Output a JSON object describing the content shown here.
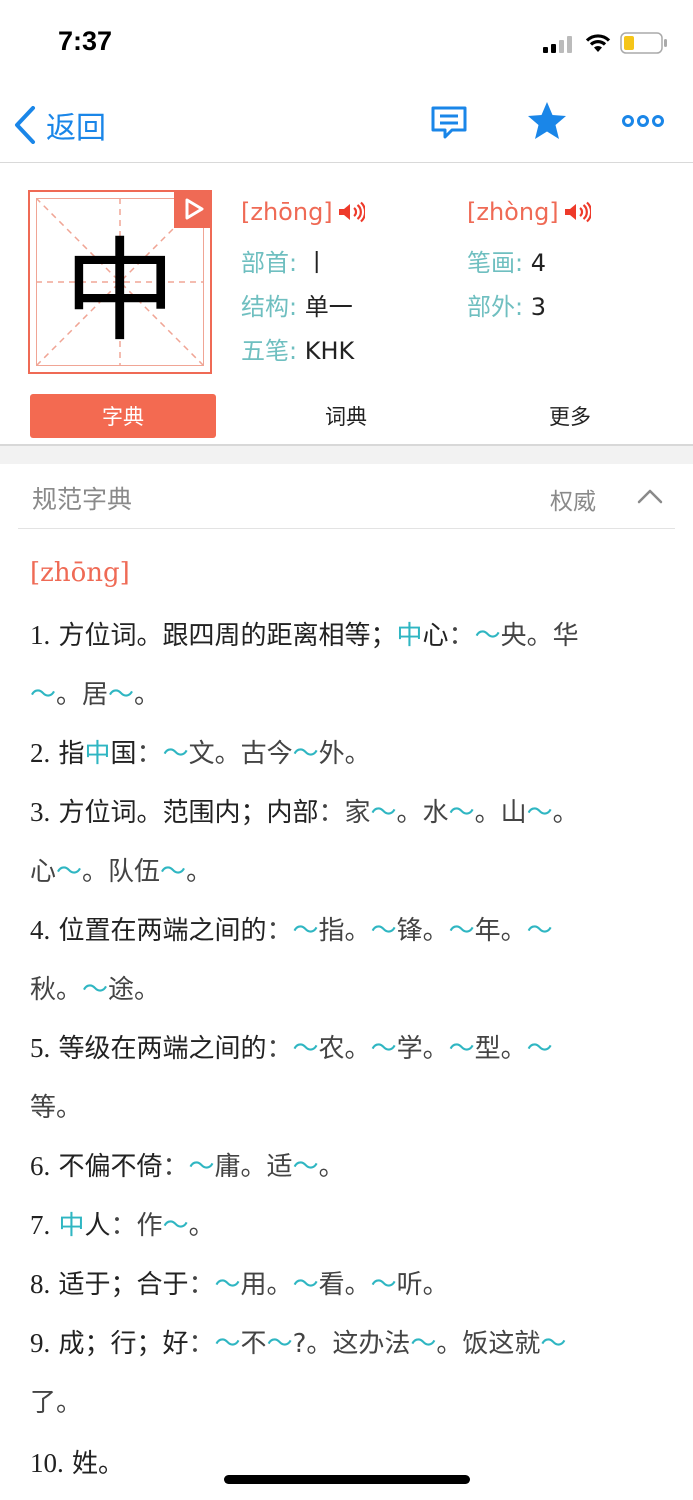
{
  "status": {
    "time": "7:37"
  },
  "nav": {
    "back_label": "返回"
  },
  "char": {
    "glyph": "中",
    "pinyin1": "[zhōng]",
    "pinyin2": "[zhòng]",
    "radical_label": "部首:",
    "radical_value": "丨",
    "strokes_label": "笔画:",
    "strokes_value": "4",
    "structure_label": "结构:",
    "structure_value": "单一",
    "extra_label": "部外:",
    "extra_value": "3",
    "wubi_label": "五笔:",
    "wubi_value": "KHK"
  },
  "tabs": [
    {
      "label": "字典"
    },
    {
      "label": "词典"
    },
    {
      "label": "更多"
    }
  ],
  "dict": {
    "title": "规范字典",
    "authority": "权威",
    "entry_pinyin": "[zhōng]"
  },
  "definitions": [
    [
      [
        [
          "n",
          "1."
        ],
        [
          "t",
          " 方位词。跟四周的距离相等；"
        ],
        [
          "c",
          "中"
        ],
        [
          "t",
          "心"
        ],
        [
          "g",
          "："
        ],
        [
          "c",
          "～"
        ],
        [
          "g",
          "央。华"
        ]
      ],
      [
        [
          "c",
          "～"
        ],
        [
          "g",
          "。居"
        ],
        [
          "c",
          "～"
        ],
        [
          "g",
          "。"
        ]
      ]
    ],
    [
      [
        [
          "n",
          "2."
        ],
        [
          "t",
          " 指"
        ],
        [
          "c",
          "中"
        ],
        [
          "t",
          "国"
        ],
        [
          "g",
          "："
        ],
        [
          "c",
          "～"
        ],
        [
          "g",
          "文。古今"
        ],
        [
          "c",
          "～"
        ],
        [
          "g",
          "外。"
        ]
      ]
    ],
    [
      [
        [
          "n",
          "3."
        ],
        [
          "t",
          " 方位词。范围内；内部"
        ],
        [
          "g",
          "：家"
        ],
        [
          "c",
          "～"
        ],
        [
          "g",
          "。水"
        ],
        [
          "c",
          "～"
        ],
        [
          "g",
          "。山"
        ],
        [
          "c",
          "～"
        ],
        [
          "g",
          "。"
        ]
      ],
      [
        [
          "g",
          "心"
        ],
        [
          "c",
          "～"
        ],
        [
          "g",
          "。队伍"
        ],
        [
          "c",
          "～"
        ],
        [
          "g",
          "。"
        ]
      ]
    ],
    [
      [
        [
          "n",
          "4."
        ],
        [
          "t",
          " 位置在两端之间的"
        ],
        [
          "g",
          "："
        ],
        [
          "c",
          "～"
        ],
        [
          "g",
          "指。"
        ],
        [
          "c",
          "～"
        ],
        [
          "g",
          "锋。"
        ],
        [
          "c",
          "～"
        ],
        [
          "g",
          "年。"
        ],
        [
          "c",
          "～"
        ]
      ],
      [
        [
          "g",
          "秋。"
        ],
        [
          "c",
          "～"
        ],
        [
          "g",
          "途。"
        ]
      ]
    ],
    [
      [
        [
          "n",
          "5."
        ],
        [
          "t",
          " 等级在两端之间的"
        ],
        [
          "g",
          "："
        ],
        [
          "c",
          "～"
        ],
        [
          "g",
          "农。"
        ],
        [
          "c",
          "～"
        ],
        [
          "g",
          "学。"
        ],
        [
          "c",
          "～"
        ],
        [
          "g",
          "型。"
        ],
        [
          "c",
          "～"
        ]
      ],
      [
        [
          "g",
          "等。"
        ]
      ]
    ],
    [
      [
        [
          "n",
          "6."
        ],
        [
          "t",
          " 不偏不倚"
        ],
        [
          "g",
          "："
        ],
        [
          "c",
          "～"
        ],
        [
          "g",
          "庸。适"
        ],
        [
          "c",
          "～"
        ],
        [
          "g",
          "。"
        ]
      ]
    ],
    [
      [
        [
          "n",
          "7."
        ],
        [
          "t",
          " "
        ],
        [
          "c",
          "中"
        ],
        [
          "t",
          "人"
        ],
        [
          "g",
          "：作"
        ],
        [
          "c",
          "～"
        ],
        [
          "g",
          "。"
        ]
      ]
    ],
    [
      [
        [
          "n",
          "8."
        ],
        [
          "t",
          " 适于；合于"
        ],
        [
          "g",
          "："
        ],
        [
          "c",
          "～"
        ],
        [
          "g",
          "用。"
        ],
        [
          "c",
          "～"
        ],
        [
          "g",
          "看。"
        ],
        [
          "c",
          "～"
        ],
        [
          "g",
          "听。"
        ]
      ]
    ],
    [
      [
        [
          "n",
          "9."
        ],
        [
          "t",
          " 成；行；好"
        ],
        [
          "g",
          "："
        ],
        [
          "c",
          "～"
        ],
        [
          "g",
          "不"
        ],
        [
          "c",
          "～"
        ],
        [
          "g",
          "?。这办法"
        ],
        [
          "c",
          "～"
        ],
        [
          "g",
          "。饭这就"
        ],
        [
          "c",
          "～"
        ]
      ],
      [
        [
          "g",
          "了。"
        ]
      ]
    ],
    [
      [
        [
          "n",
          "10."
        ],
        [
          "t",
          " 姓。"
        ]
      ]
    ]
  ]
}
